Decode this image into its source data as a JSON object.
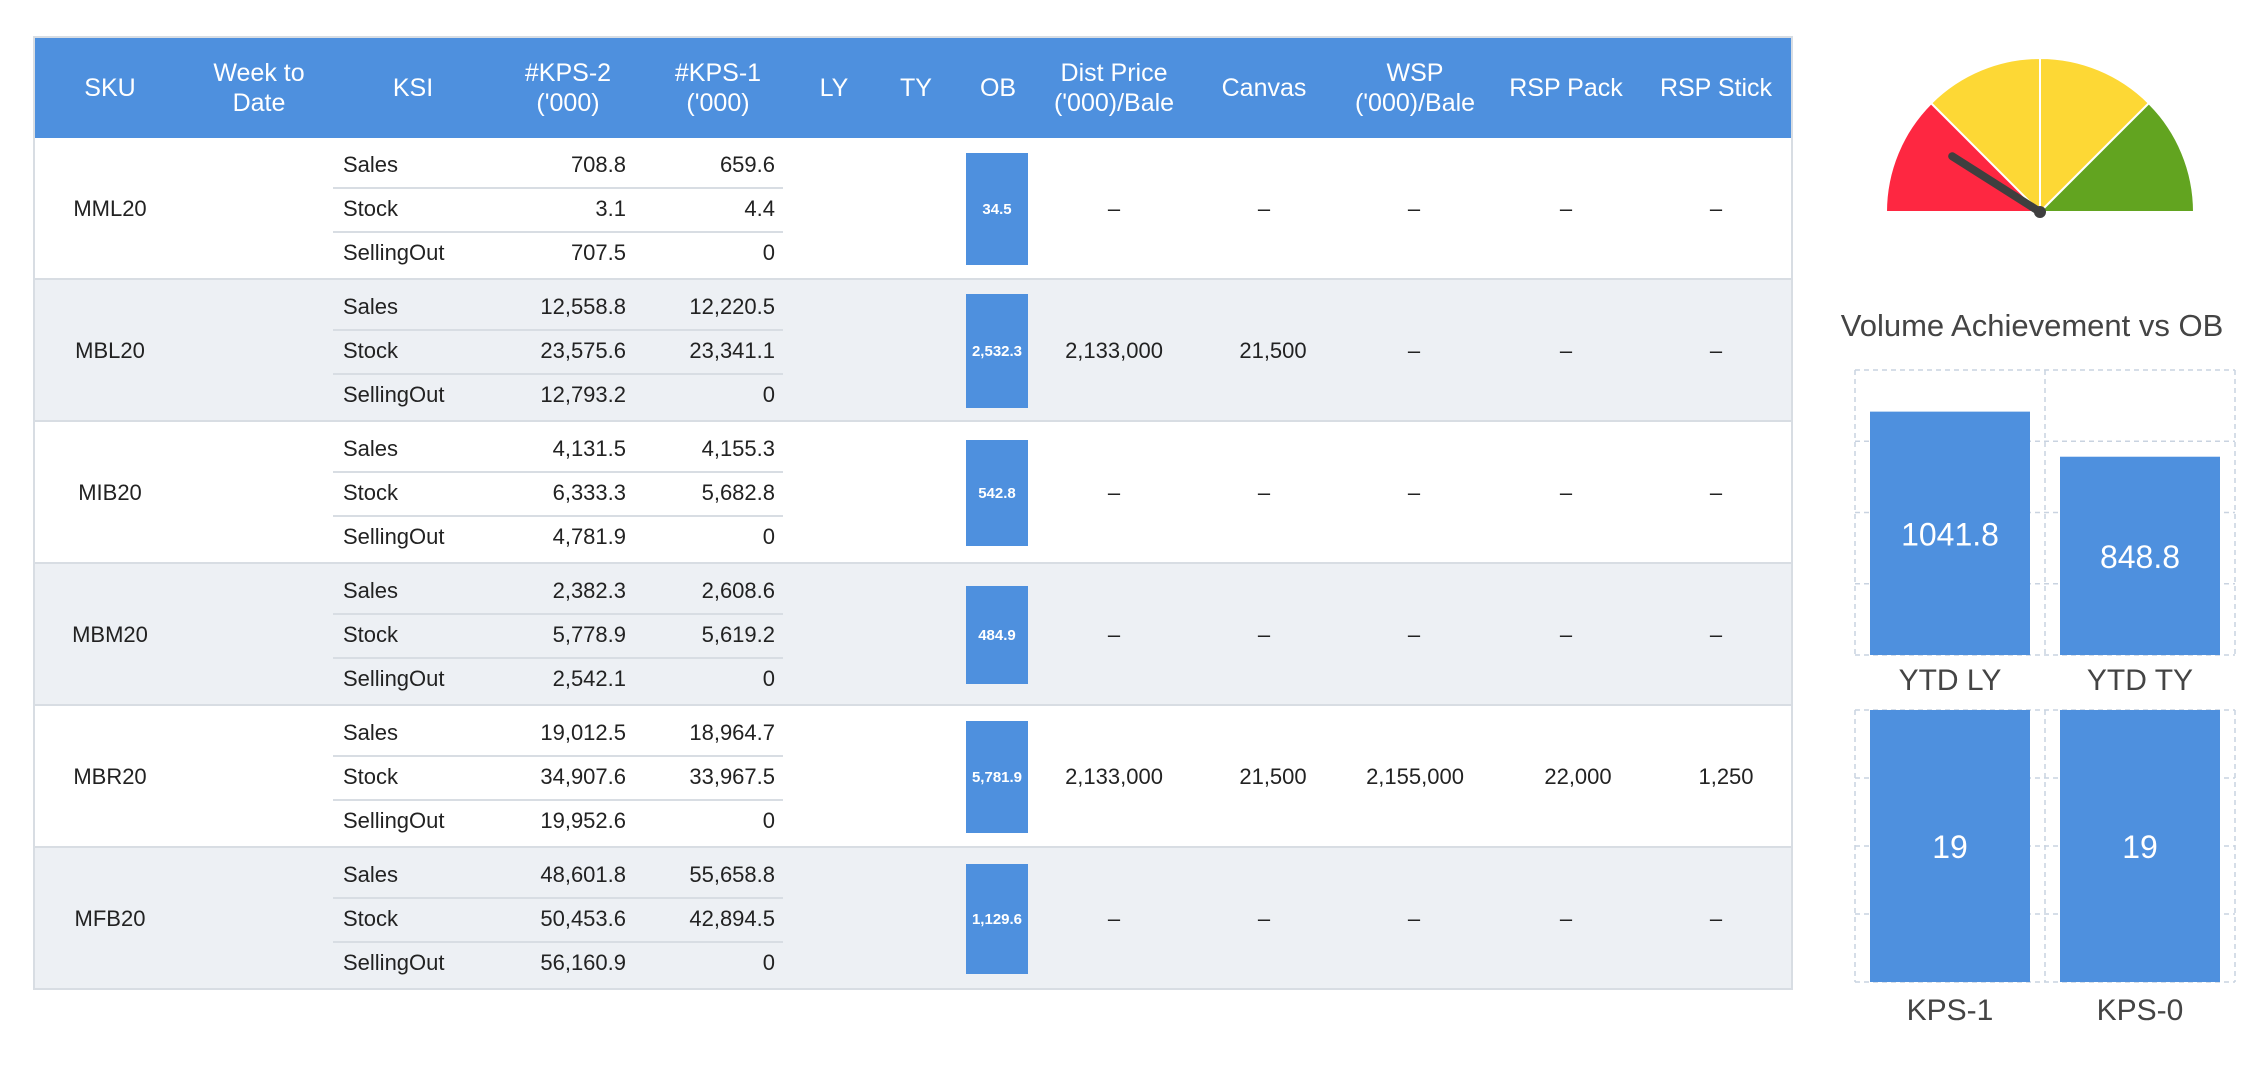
{
  "table": {
    "headers": [
      "SKU",
      "Week to\nDate",
      "KSI",
      "#KPS-2\n('000)",
      "#KPS-1\n('000)",
      "LY",
      "TY",
      "OB",
      "Dist Price\n('000)/Bale",
      "Canvas",
      "WSP\n('000)/Bale",
      "RSP Pack",
      "RSP Stick"
    ],
    "rows": [
      {
        "sku": "MML20",
        "ksi": [
          [
            "Sales",
            "708.8",
            "659.6"
          ],
          [
            "Stock",
            "3.1",
            "4.4"
          ],
          [
            "SellingOut",
            "707.5",
            "0"
          ]
        ],
        "ob": "34.5",
        "dist_price": "–",
        "canvas": "–",
        "wsp": "–",
        "rsp_pack": "–",
        "rsp_stick": "–"
      },
      {
        "sku": "MBL20",
        "ksi": [
          [
            "Sales",
            "12,558.8",
            "12,220.5"
          ],
          [
            "Stock",
            "23,575.6",
            "23,341.1"
          ],
          [
            "SellingOut",
            "12,793.2",
            "0"
          ]
        ],
        "ob": "2,532.3",
        "dist_price": "2,133,000",
        "canvas": "21,500",
        "wsp": "–",
        "rsp_pack": "–",
        "rsp_stick": "–"
      },
      {
        "sku": "MIB20",
        "ksi": [
          [
            "Sales",
            "4,131.5",
            "4,155.3"
          ],
          [
            "Stock",
            "6,333.3",
            "5,682.8"
          ],
          [
            "SellingOut",
            "4,781.9",
            "0"
          ]
        ],
        "ob": "542.8",
        "dist_price": "–",
        "canvas": "–",
        "wsp": "–",
        "rsp_pack": "–",
        "rsp_stick": "–"
      },
      {
        "sku": "MBM20",
        "ksi": [
          [
            "Sales",
            "2,382.3",
            "2,608.6"
          ],
          [
            "Stock",
            "5,778.9",
            "5,619.2"
          ],
          [
            "SellingOut",
            "2,542.1",
            "0"
          ]
        ],
        "ob": "484.9",
        "dist_price": "–",
        "canvas": "–",
        "wsp": "–",
        "rsp_pack": "–",
        "rsp_stick": "–"
      },
      {
        "sku": "MBR20",
        "ksi": [
          [
            "Sales",
            "19,012.5",
            "18,964.7"
          ],
          [
            "Stock",
            "34,907.6",
            "33,967.5"
          ],
          [
            "SellingOut",
            "19,952.6",
            "0"
          ]
        ],
        "ob": "5,781.9",
        "dist_price": "2,133,000",
        "canvas": "21,500",
        "wsp": "2,155,000",
        "rsp_pack": "22,000",
        "rsp_stick": "1,250"
      },
      {
        "sku": "MFB20",
        "ksi": [
          [
            "Sales",
            "48,601.8",
            "55,658.8"
          ],
          [
            "Stock",
            "50,453.6",
            "42,894.5"
          ],
          [
            "SellingOut",
            "56,160.9",
            "0"
          ]
        ],
        "ob": "1,129.6",
        "dist_price": "–",
        "canvas": "–",
        "wsp": "–",
        "rsp_pack": "–",
        "rsp_stick": "–"
      }
    ]
  },
  "gauge": {
    "zone_colors": [
      "#fe2741",
      "#fdd835",
      "#fdd835",
      "#62a420"
    ],
    "needle_color": "#3f3f3f",
    "needle_value": 0.18
  },
  "chart_data": [
    {
      "type": "bar",
      "title": "Volume Achievement vs OB",
      "categories": [
        "YTD LY",
        "YTD TY"
      ],
      "values": [
        1041.8,
        848.8
      ],
      "ylim": [
        0,
        1220
      ],
      "color": "#4e90de",
      "grid": true
    },
    {
      "type": "bar",
      "title": "",
      "categories": [
        "KPS-1",
        "KPS-0"
      ],
      "values": [
        19,
        19
      ],
      "ylim": [
        0,
        19
      ],
      "color": "#4e90de",
      "grid": true
    }
  ]
}
